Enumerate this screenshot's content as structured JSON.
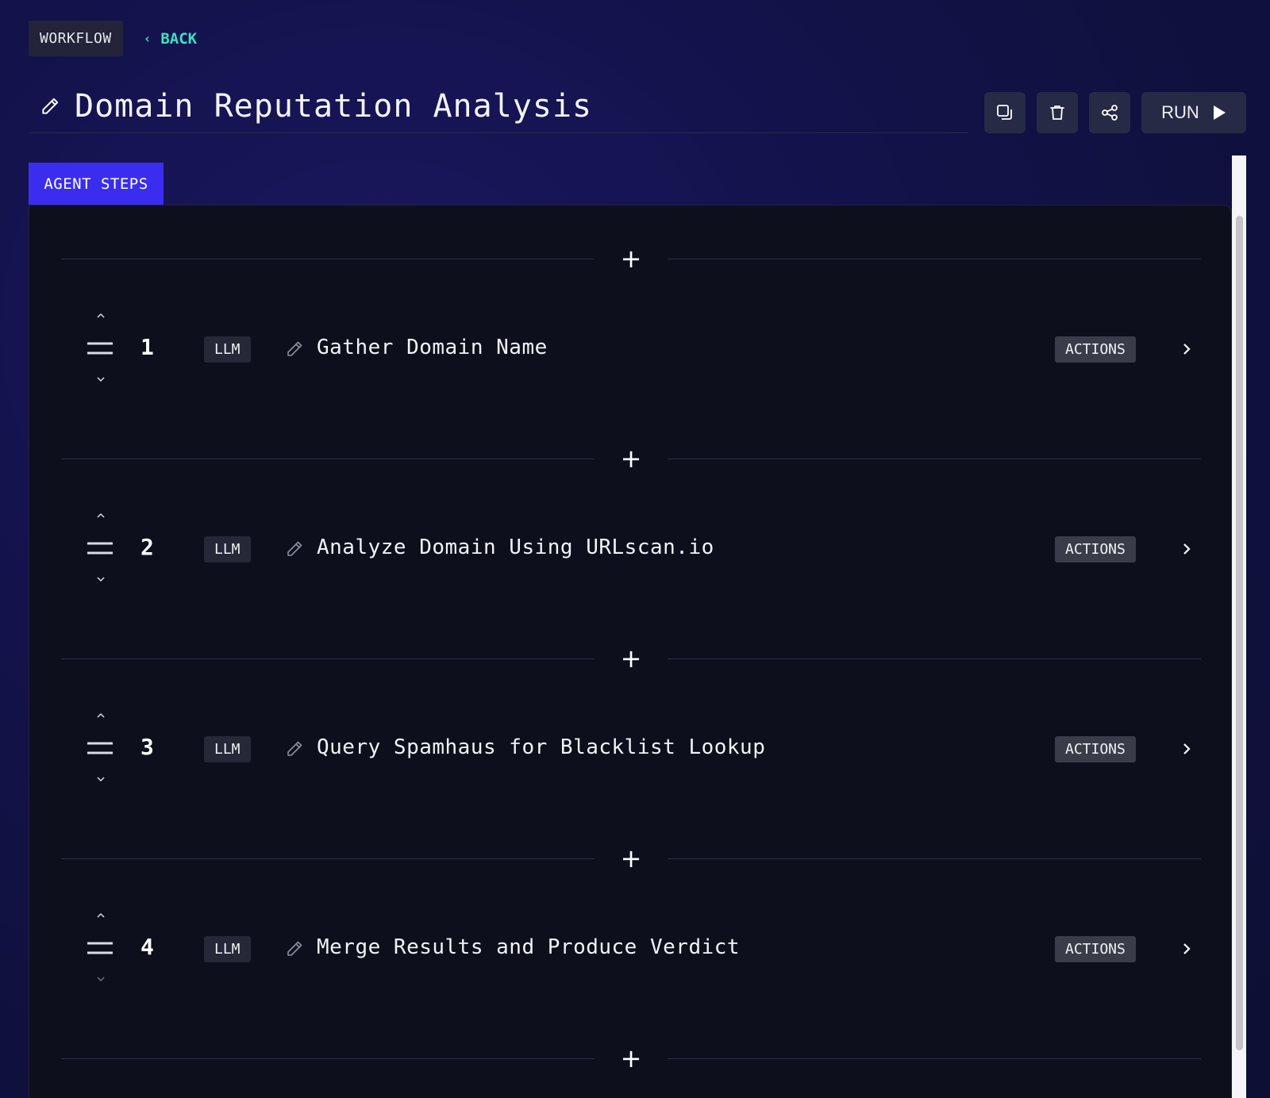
{
  "nav": {
    "crumb": "WORKFLOW",
    "back_label": "BACK"
  },
  "header": {
    "title": "Domain Reputation Analysis",
    "run_label": "RUN",
    "toolbar_icons": [
      "duplicate-icon",
      "trash-icon",
      "share-icon",
      "play-icon"
    ]
  },
  "tabs": {
    "active": "AGENT STEPS"
  },
  "steps": [
    {
      "number": "1",
      "type": "LLM",
      "label": "Gather Domain Name",
      "actions": "ACTIONS"
    },
    {
      "number": "2",
      "type": "LLM",
      "label": "Analyze Domain Using URLscan.io",
      "actions": "ACTIONS"
    },
    {
      "number": "3",
      "type": "LLM",
      "label": "Query Spamhaus for Blacklist Lookup",
      "actions": "ACTIONS"
    },
    {
      "number": "4",
      "type": "LLM",
      "label": "Merge Results and Produce Verdict",
      "actions": "ACTIONS"
    }
  ],
  "add_symbol": "+",
  "colors": {
    "accent_tab": "#3a2df0",
    "back_link": "#3fe0c0",
    "panel_bg": "#0d0f1d"
  }
}
